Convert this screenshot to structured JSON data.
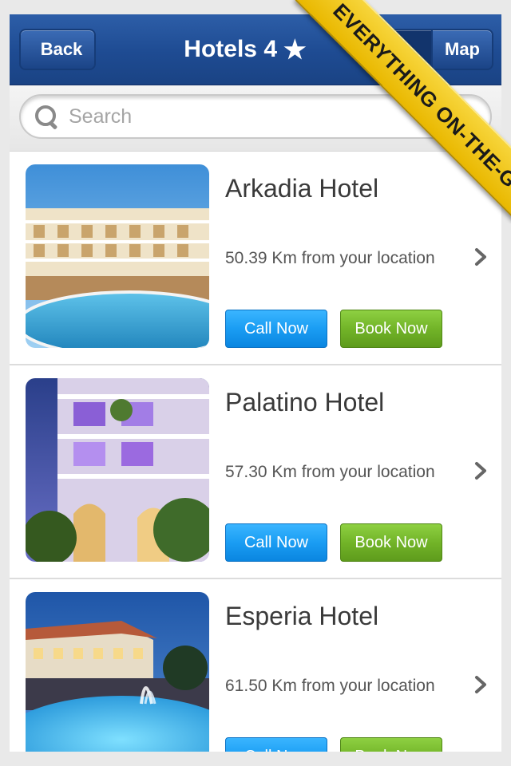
{
  "navbar": {
    "back_label": "Back",
    "title": "Hotels 4",
    "title_star": "★",
    "map_label": "Map"
  },
  "search": {
    "placeholder": "Search",
    "value": ""
  },
  "hotels": [
    {
      "name": "Arkadia Hotel",
      "distance": "50.39 Km from your location",
      "call_label": "Call Now",
      "book_label": "Book Now"
    },
    {
      "name": "Palatino Hotel",
      "distance": "57.30 Km from your location",
      "call_label": "Call Now",
      "book_label": "Book Now"
    },
    {
      "name": "Esperia Hotel",
      "distance": "61.50 Km from your location",
      "call_label": "Call Now",
      "book_label": "Book Now"
    }
  ],
  "ribbon": {
    "text": "EVERYTHING ON-THE-GO"
  },
  "colors": {
    "navbar": "#1e4b92",
    "call_button": "#1a9df3",
    "book_button": "#72b428",
    "ribbon": "#f2c81b"
  },
  "icons": [
    "search-icon",
    "chevron-right-icon",
    "star-icon"
  ]
}
